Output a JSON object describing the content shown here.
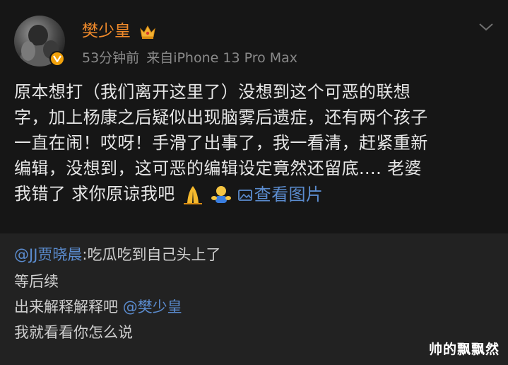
{
  "post": {
    "username": "樊少皇",
    "time": "53分钟前",
    "source": "来自iPhone 13 Pro Max",
    "body_lines": [
      "原本想打（我们离开这里了）没想到这个可恶的联想",
      "字，加上杨康之后疑似出现脑雾后遗症，还有两个孩子",
      "一直在闹！哎呀！手滑了出事了，我一看清，赶紧重新",
      "编辑，没想到，这可恶的编辑设定竟然还留底.... 老婆"
    ],
    "last_line_text": "我错了 求你原谅我吧",
    "image_link": "查看图片",
    "icons": [
      "avatar",
      "crown-icon",
      "verified-icon",
      "chevron-down-icon",
      "pray-emoji",
      "hug-emoji",
      "image-icon"
    ]
  },
  "comments": {
    "first_mention": "@JJ贾晓晨",
    "first_text": ":吃瓜吃到自己头上了",
    "lines": [
      "等后续"
    ],
    "third_text": "出来解释解释吧 ",
    "third_mention": "@樊少皇",
    "last_line": "我就看看你怎么说"
  },
  "watermark": "帅的飘飘然",
  "colors": {
    "background": "#161616",
    "comment_background": "#222222",
    "username": "#f08a2b",
    "link": "#5b8ccf",
    "body_text": "#e6e6e6",
    "meta_text": "#8a8a8a"
  }
}
